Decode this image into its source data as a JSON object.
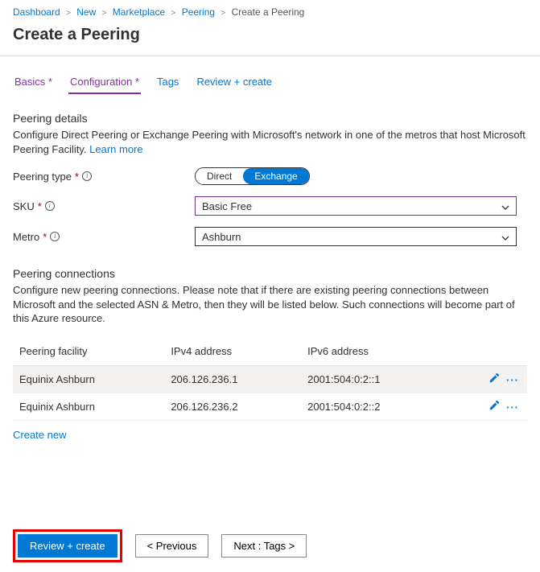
{
  "breadcrumb": {
    "items": [
      {
        "label": "Dashboard"
      },
      {
        "label": "New"
      },
      {
        "label": "Marketplace"
      },
      {
        "label": "Peering"
      }
    ],
    "current": "Create a Peering"
  },
  "page": {
    "title": "Create a Peering"
  },
  "tabs": {
    "basics": "Basics",
    "configuration": "Configuration",
    "tags": "Tags",
    "review": "Review + create"
  },
  "details": {
    "title": "Peering details",
    "desc": "Configure Direct Peering or Exchange Peering with Microsoft's network in one of the metros that host Microsoft Peering Facility. ",
    "learn_more": "Learn more"
  },
  "fields": {
    "peering_type_label": "Peering type",
    "peering_type_opt_direct": "Direct",
    "peering_type_opt_exchange": "Exchange",
    "sku_label": "SKU",
    "sku_value": "Basic Free",
    "metro_label": "Metro",
    "metro_value": "Ashburn"
  },
  "connections": {
    "title": "Peering connections",
    "desc": "Configure new peering connections. Please note that if there are existing peering connections between Microsoft and the selected ASN & Metro, then they will be listed below. Such connections will become part of this Azure resource.",
    "cols": {
      "facility": "Peering facility",
      "ipv4": "IPv4 address",
      "ipv6": "IPv6 address"
    },
    "rows": [
      {
        "facility": "Equinix Ashburn",
        "ipv4": "206.126.236.1",
        "ipv6": "2001:504:0:2::1"
      },
      {
        "facility": "Equinix Ashburn",
        "ipv4": "206.126.236.2",
        "ipv6": "2001:504:0:2::2"
      }
    ],
    "create_new": "Create new"
  },
  "footer": {
    "review": "Review + create",
    "previous": "< Previous",
    "next": "Next : Tags >"
  }
}
